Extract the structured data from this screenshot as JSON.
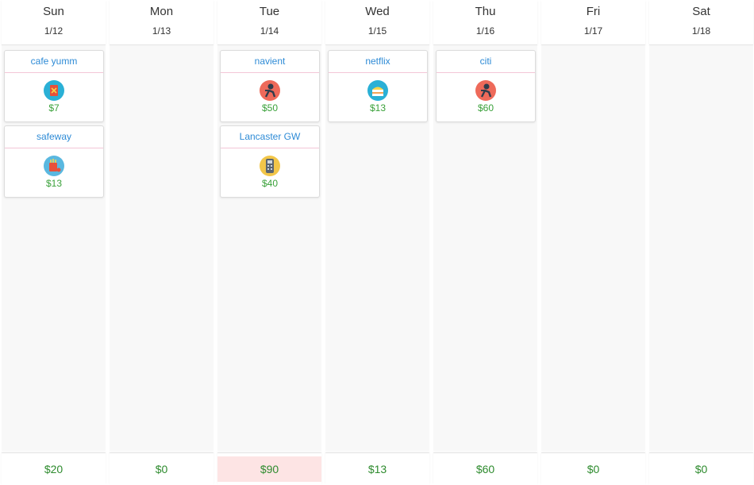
{
  "colors": {
    "title_link": "#2e8bd6",
    "amount": "#3aa13a",
    "total": "#2e8b2e",
    "over_budget_bg": "#fde4e4",
    "divider": "#f3c6d6"
  },
  "days": [
    {
      "name": "Sun",
      "date": "1/12",
      "total": "$20",
      "total_over": false,
      "transactions": [
        {
          "title": "cafe yumm",
          "amount": "$7",
          "icon": "food-drink-icon"
        },
        {
          "title": "safeway",
          "amount": "$13",
          "icon": "groceries-icon"
        }
      ]
    },
    {
      "name": "Mon",
      "date": "1/13",
      "total": "$0",
      "total_over": false,
      "transactions": []
    },
    {
      "name": "Tue",
      "date": "1/14",
      "total": "$90",
      "total_over": true,
      "transactions": [
        {
          "title": "navient",
          "amount": "$50",
          "icon": "person-icon"
        },
        {
          "title": "Lancaster GW",
          "amount": "$40",
          "icon": "payment-terminal-icon"
        }
      ]
    },
    {
      "name": "Wed",
      "date": "1/15",
      "total": "$13",
      "total_over": false,
      "transactions": [
        {
          "title": "netflix",
          "amount": "$13",
          "icon": "cake-icon"
        }
      ]
    },
    {
      "name": "Thu",
      "date": "1/16",
      "total": "$60",
      "total_over": false,
      "transactions": [
        {
          "title": "citi",
          "amount": "$60",
          "icon": "person-icon"
        }
      ]
    },
    {
      "name": "Fri",
      "date": "1/17",
      "total": "$0",
      "total_over": false,
      "transactions": []
    },
    {
      "name": "Sat",
      "date": "1/18",
      "total": "$0",
      "total_over": false,
      "transactions": []
    }
  ]
}
